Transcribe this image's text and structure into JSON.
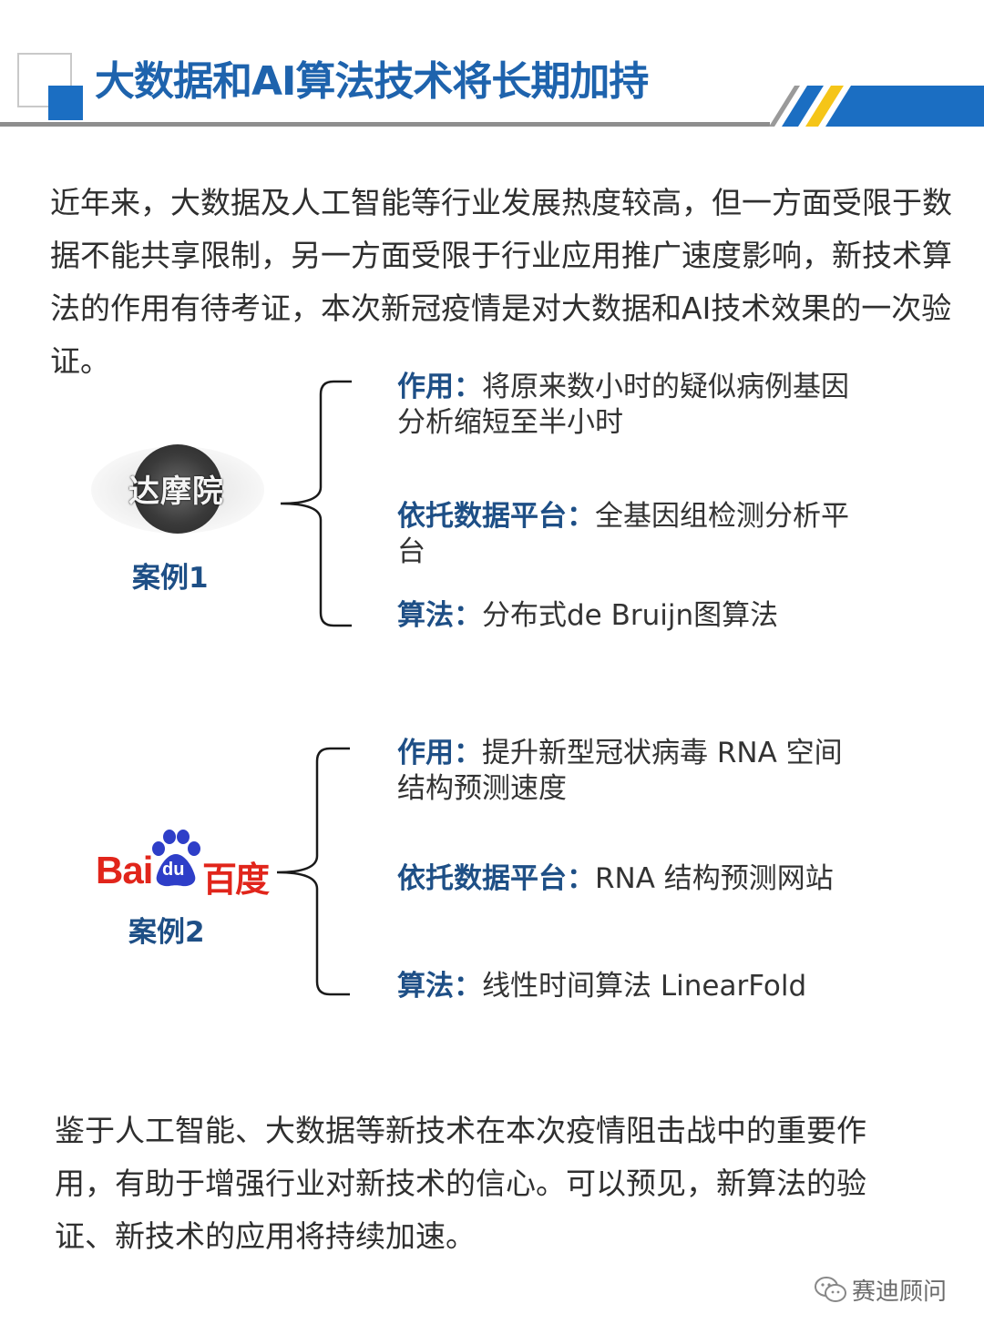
{
  "header": {
    "title": "大数据和AI算法技术将长期加持",
    "colors": {
      "blue": "#1b6ec2",
      "yellow": "#f5c518",
      "gray": "#8e8e8e"
    }
  },
  "intro_text": "近年来，大数据及人工智能等行业发展热度较高，但一方面受限于数据不能共享限制，另一方面受限于行业应用推广速度影响，新技术算法的作用有待考证，本次新冠疫情是对大数据和AI技术效果的一次验证。",
  "case1": {
    "logo_text": "达摩院",
    "label": "案例1",
    "items": [
      {
        "key": "作用：",
        "value": "将原来数小时的疑似病例基因分析缩短至半小时"
      },
      {
        "key": "依托数据平台：",
        "value": "全基因组检测分析平台"
      },
      {
        "key": "算法：",
        "value": "分布式de Bruijn图算法"
      }
    ]
  },
  "case2": {
    "logo": {
      "latin": "Bai",
      "badge": "du",
      "chinese": "百度"
    },
    "label": "案例2",
    "items": [
      {
        "key": "作用：",
        "value": "提升新型冠状病毒 RNA 空间结构预测速度"
      },
      {
        "key": "依托数据平台：",
        "value": "RNA 结构预测网站"
      },
      {
        "key": "算法：",
        "value": "线性时间算法 LinearFold"
      }
    ]
  },
  "outro_text": "鉴于人工智能、大数据等新技术在本次疫情阻击战中的重要作用，有助于增强行业对新技术的信心。可以预见，新算法的验证、新技术的应用将持续加速。",
  "watermark": {
    "icon": "wechat-icon",
    "text": "赛迪顾问"
  }
}
